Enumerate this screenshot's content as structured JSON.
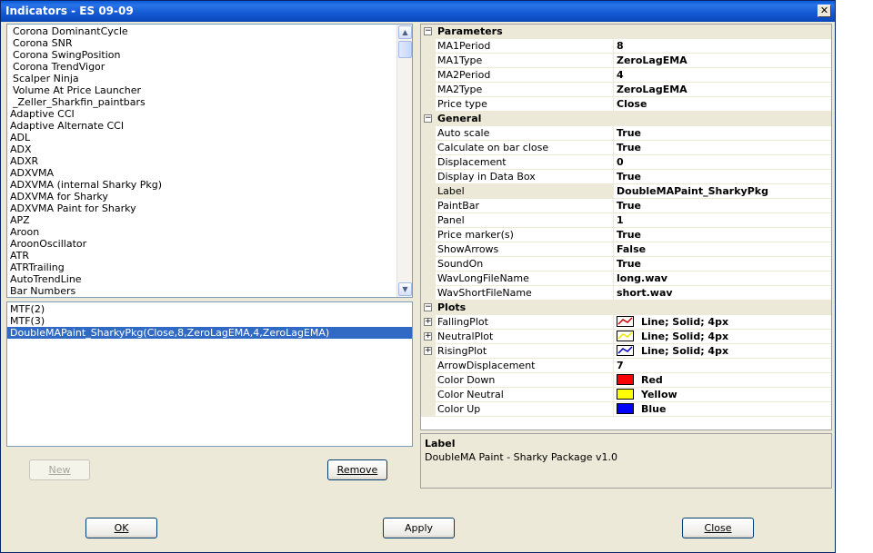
{
  "window": {
    "title": "Indicators - ES 09-09",
    "close_glyph": "✕"
  },
  "indicator_list": {
    "items": [
      "Corona DominantCycle",
      "Corona SNR",
      "Corona SwingPosition",
      "Corona TrendVigor",
      "Scalper Ninja",
      "Volume At Price Launcher",
      "_Zeller_Sharkfin_paintbars",
      "Adaptive  CCI",
      "Adaptive Alternate CCI",
      "ADL",
      "ADX",
      "ADXR",
      "ADXVMA",
      "ADXVMA (internal Sharky Pkg)",
      "ADXVMA for Sharky",
      "ADXVMA Paint for Sharky",
      "APZ",
      "Aroon",
      "AroonOscillator",
      "ATR",
      "ATRTrailing",
      "AutoTrendLine",
      "Bar Numbers"
    ],
    "indented_count": 7
  },
  "applied_list": {
    "items": [
      "MTF(2)",
      "MTF(3)",
      "DoubleMAPaint_SharkyPkg(Close,8,ZeroLagEMA,4,ZeroLagEMA)"
    ],
    "selected_index": 2
  },
  "buttons": {
    "new": "New",
    "remove": "Remove",
    "ok": "OK",
    "apply": "Apply",
    "close": "Close"
  },
  "properties": {
    "parameters": {
      "label": "Parameters",
      "rows": [
        {
          "name": "MA1Period",
          "value": "8"
        },
        {
          "name": "MA1Type",
          "value": "ZeroLagEMA"
        },
        {
          "name": "MA2Period",
          "value": "4"
        },
        {
          "name": "MA2Type",
          "value": "ZeroLagEMA"
        },
        {
          "name": "Price type",
          "value": "Close"
        }
      ]
    },
    "general": {
      "label": "General",
      "rows": [
        {
          "name": "Auto scale",
          "value": "True"
        },
        {
          "name": "Calculate on bar close",
          "value": "True"
        },
        {
          "name": "Displacement",
          "value": "0"
        },
        {
          "name": "Display in Data Box",
          "value": "True"
        },
        {
          "name": "Label",
          "value": "DoubleMAPaint_SharkyPkg"
        },
        {
          "name": "PaintBar",
          "value": "True"
        },
        {
          "name": "Panel",
          "value": "1"
        },
        {
          "name": "Price marker(s)",
          "value": "True"
        },
        {
          "name": "ShowArrows",
          "value": "False"
        },
        {
          "name": "SoundOn",
          "value": "True"
        },
        {
          "name": "WavLongFileName",
          "value": "long.wav"
        },
        {
          "name": "WavShortFileName",
          "value": "short.wav"
        }
      ],
      "selected_index": 4
    },
    "plots": {
      "label": "Plots",
      "rows": [
        {
          "name": "FallingPlot",
          "value": "Line; Solid; 4px",
          "line_color": "#d00000"
        },
        {
          "name": "NeutralPlot",
          "value": "Line; Solid; 4px",
          "line_color": "#e8e800"
        },
        {
          "name": "RisingPlot",
          "value": "Line; Solid; 4px",
          "line_color": "#0000c0"
        },
        {
          "name": "ArrowDisplacement",
          "value": "7"
        },
        {
          "name": "Color Down",
          "value": "Red",
          "swatch": "#ff0000"
        },
        {
          "name": "Color Neutral",
          "value": "Yellow",
          "swatch": "#ffff00"
        },
        {
          "name": "Color Up",
          "value": "Blue",
          "swatch": "#0000ff"
        }
      ]
    }
  },
  "description": {
    "title": "Label",
    "text": "DoubleMA Paint - Sharky Package v1.0"
  }
}
